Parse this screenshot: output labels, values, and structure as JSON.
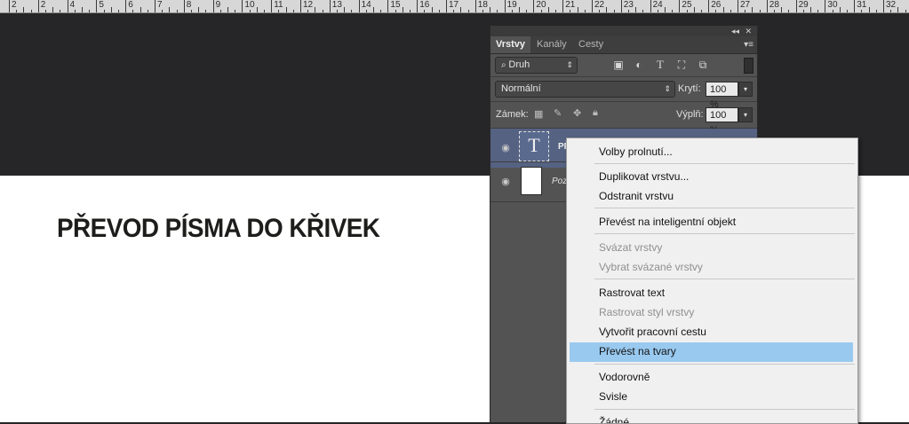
{
  "ruler": {
    "labels": [
      "2",
      "2",
      "4",
      "5",
      "6",
      "7",
      "8",
      "9",
      "10",
      "11",
      "12",
      "13",
      "14",
      "15",
      "16",
      "17",
      "18",
      "19",
      "20",
      "21",
      "22",
      "23",
      "24",
      "25",
      "26",
      "27",
      "28",
      "29",
      "30",
      "31",
      "32"
    ]
  },
  "document": {
    "heading": "PŘEVOD PÍSMA DO KŘIVEK"
  },
  "panel": {
    "collapse_glyph": "◂◂",
    "close_glyph": "✕",
    "tabs": [
      {
        "label": "Vrstvy"
      },
      {
        "label": "Kanály"
      },
      {
        "label": "Cesty"
      }
    ],
    "menu_glyph": "▾≡",
    "filter": {
      "label": "Druh",
      "icons": [
        "image-filter-icon",
        "adjustment-filter-icon",
        "type-filter-icon",
        "shape-filter-icon",
        "smart-object-filter-icon"
      ]
    },
    "blend_mode": "Normální",
    "opacity_label": "Krytí:",
    "opacity_value": "100 %",
    "lock_label": "Zámek:",
    "fill_label": "Výplň:",
    "fill_value": "100 %",
    "layers": [
      {
        "name": "PŘ",
        "kind": "text",
        "selected": true
      },
      {
        "name": "Poza",
        "kind": "background",
        "selected": false
      }
    ]
  },
  "context_menu": {
    "items": [
      {
        "label": "Volby prolnutí...",
        "disabled": false
      },
      {
        "label": "Duplikovat vrstvu...",
        "disabled": false
      },
      {
        "label": "Odstranit vrstvu",
        "disabled": false
      },
      {
        "label": "Převést na inteligentní objekt",
        "disabled": false
      },
      {
        "label": "Svázat vrstvy",
        "disabled": true
      },
      {
        "label": "Vybrat svázané vrstvy",
        "disabled": true
      },
      {
        "label": "Rastrovat text",
        "disabled": false
      },
      {
        "label": "Rastrovat styl vrstvy",
        "disabled": true
      },
      {
        "label": "Vytvořit pracovní cestu",
        "disabled": false
      },
      {
        "label": "Převést na tvary",
        "disabled": false,
        "highlighted": true
      },
      {
        "label": "Vodorovně",
        "disabled": false
      },
      {
        "label": "Svisle",
        "disabled": false
      },
      {
        "label": "Žádné",
        "disabled": false
      }
    ]
  },
  "colors": {
    "highlight": "#99c9ef",
    "panel": "#535353",
    "canvas": "#262527"
  }
}
